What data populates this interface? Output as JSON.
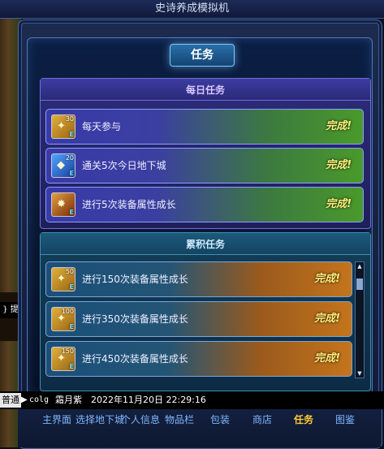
{
  "window": {
    "title": "史诗养成模拟机"
  },
  "panel": {
    "tab_title": "任务"
  },
  "daily": {
    "title": "每日任务",
    "tasks": [
      {
        "name": "每天参与",
        "badge": "30",
        "status": "完成!",
        "icon": "gold-coin-icon"
      },
      {
        "name": "通关5次今日地下城",
        "badge": "20",
        "status": "完成!",
        "icon": "blue-crystal-icon"
      },
      {
        "name": "进行5次装备属性成长",
        "badge": "",
        "status": "完成!",
        "icon": "fire-scroll-icon"
      }
    ]
  },
  "cumulative": {
    "title": "累积任务",
    "tasks": [
      {
        "name": "进行150次装备属性成长",
        "badge": "50",
        "status": "完成!",
        "icon": "gold-coin-icon"
      },
      {
        "name": "进行350次装备属性成长",
        "badge": "100",
        "status": "完成!",
        "icon": "gold-coin-icon"
      },
      {
        "name": "进行450次装备属性成长",
        "badge": "150",
        "status": "完成!",
        "icon": "gold-coin-icon"
      }
    ]
  },
  "status_bar": {
    "channel": "普通",
    "user": "colg",
    "name": "霜月紫",
    "time": "2022年11月20日 22:29:16",
    "side_label": "} 提"
  },
  "nav": {
    "items": [
      "主界面",
      "选择地下城",
      "个人信息",
      "物品栏",
      "包装",
      "商店",
      "任务",
      "图鉴"
    ],
    "active_index": 6
  },
  "colors": {
    "complete_text": "#fff07a",
    "active_nav": "#ffcc33",
    "nav": "#7fb8ff"
  }
}
